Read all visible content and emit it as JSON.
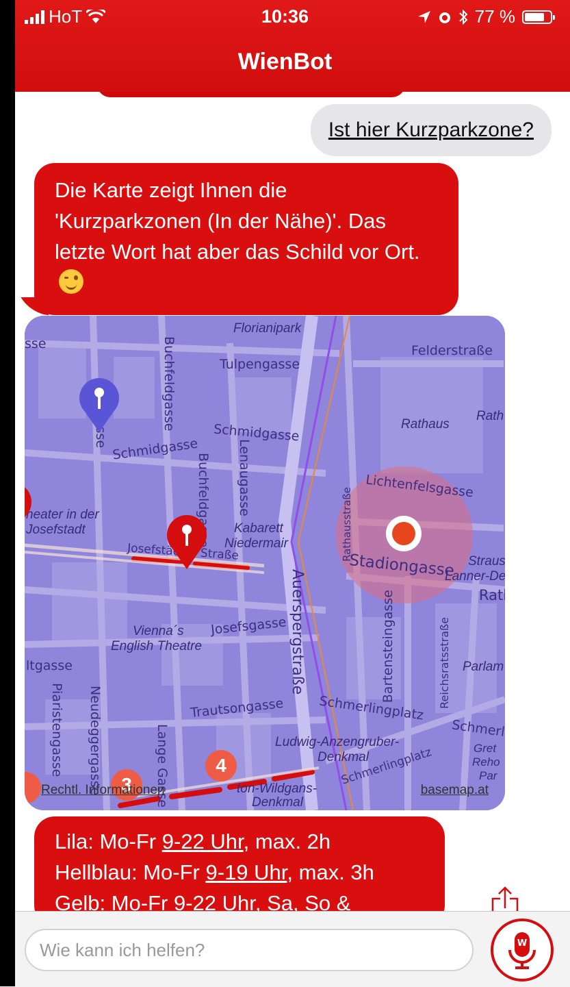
{
  "status_bar": {
    "carrier": "HoT",
    "time": "10:36",
    "battery": "77 %",
    "battery_level": 0.77
  },
  "header": {
    "title": "WienBot"
  },
  "messages": {
    "user_query": "Ist hier Kurzparkzone?",
    "bot_map_intro": "Die Karte zeigt Ihnen die 'Kurzparkzonen (In der Nähe)'. Das letzte Wort hat aber das Schild vor Ort.",
    "bot_zones": {
      "line1_prefix": "Lila: Mo-Fr ",
      "line1_link": "9-22 Uhr",
      "line1_suffix": ", max. 2h",
      "line2_prefix": "Hellblau: Mo-Fr ",
      "line2_link": "9-19 Uhr",
      "line2_suffix": ", max. 3h",
      "line3": "Gelb: Mo-Fr 9-22 Uhr, Sa, So &"
    }
  },
  "map": {
    "labels": {
      "florianipark": "Florianipark",
      "felderstrasse": "Felderstraße",
      "tulpengasse": "Tulpengasse",
      "buchfeldgasse": "Buchfeldgasse",
      "rathaus": "Rathaus",
      "rath": "Rath",
      "schmidgasse_1": "Schmidgasse",
      "schmidgasse_2": "Schmidgasse",
      "lenaugasse": "Lenaugasse",
      "buchfeldgasse_2": "Buchfeldgasse",
      "lichtenfelsgasse": "Lichtenfelsgasse",
      "theater": "heater in der",
      "josefstadt": "Josefstadt",
      "kabarett": "Kabarett",
      "niedermair": "Niedermair",
      "rathausstrasse": "Rathausstraße",
      "stadiongasse": "Stadiongasse",
      "josefstaedter": "Josefstädter Straße",
      "straus": "Straus",
      "lanner": "Lanner-De",
      "rath2": "Rath",
      "auerspergstrasse": "Auerspergstraße",
      "viennas": "Vienna´s",
      "english_theatre": "English Theatre",
      "josefsgasse": "Josefsgasse",
      "bartensteingasse": "Bartensteingasse",
      "reichsratsstrasse": "Reichsratsstraße",
      "parlam": "Parlam",
      "ltgasse": "ltgasse",
      "piaristengasse": "Piaristengasse",
      "neudeggergasse": "Neudeggergasse",
      "lange_gasse": "Lange Gasse",
      "trautsongasse": "Trautsongasse",
      "schmerlingplatz": "Schmerlingplatz",
      "schmerli": "Schmerli",
      "ludwig": "Ludwig-Anzengruber-",
      "denkmal": "Denkmal",
      "schmerlingplatz2": "Schmerlingplatz",
      "gret": "Gret",
      "reho": "Reho",
      "par": "Par",
      "wildgans": "ton-Wildgans-",
      "denkmal2": "Denkmal",
      "rechtl": "Rechtl. Informationen",
      "basemap": "basemap.at",
      "asse": "asse",
      "sse": "sse"
    },
    "clusters": [
      "3",
      "4"
    ],
    "colors": {
      "overlay": "#8f85da",
      "street": "#b7aee8",
      "parking_line": "#d40e0e",
      "location": "#e8461f"
    }
  },
  "input": {
    "placeholder": "Wie kann ich helfen?"
  },
  "icons": {
    "signal": "signal-bars-icon",
    "wifi": "wifi-icon",
    "location": "location-arrow-icon",
    "alarm": "alarm-icon",
    "bluetooth": "bluetooth-icon",
    "share": "share-icon",
    "mic": "microphone-icon"
  },
  "colors": {
    "brand_red": "#d90f0f",
    "user_bubble": "#e5e5ea"
  }
}
